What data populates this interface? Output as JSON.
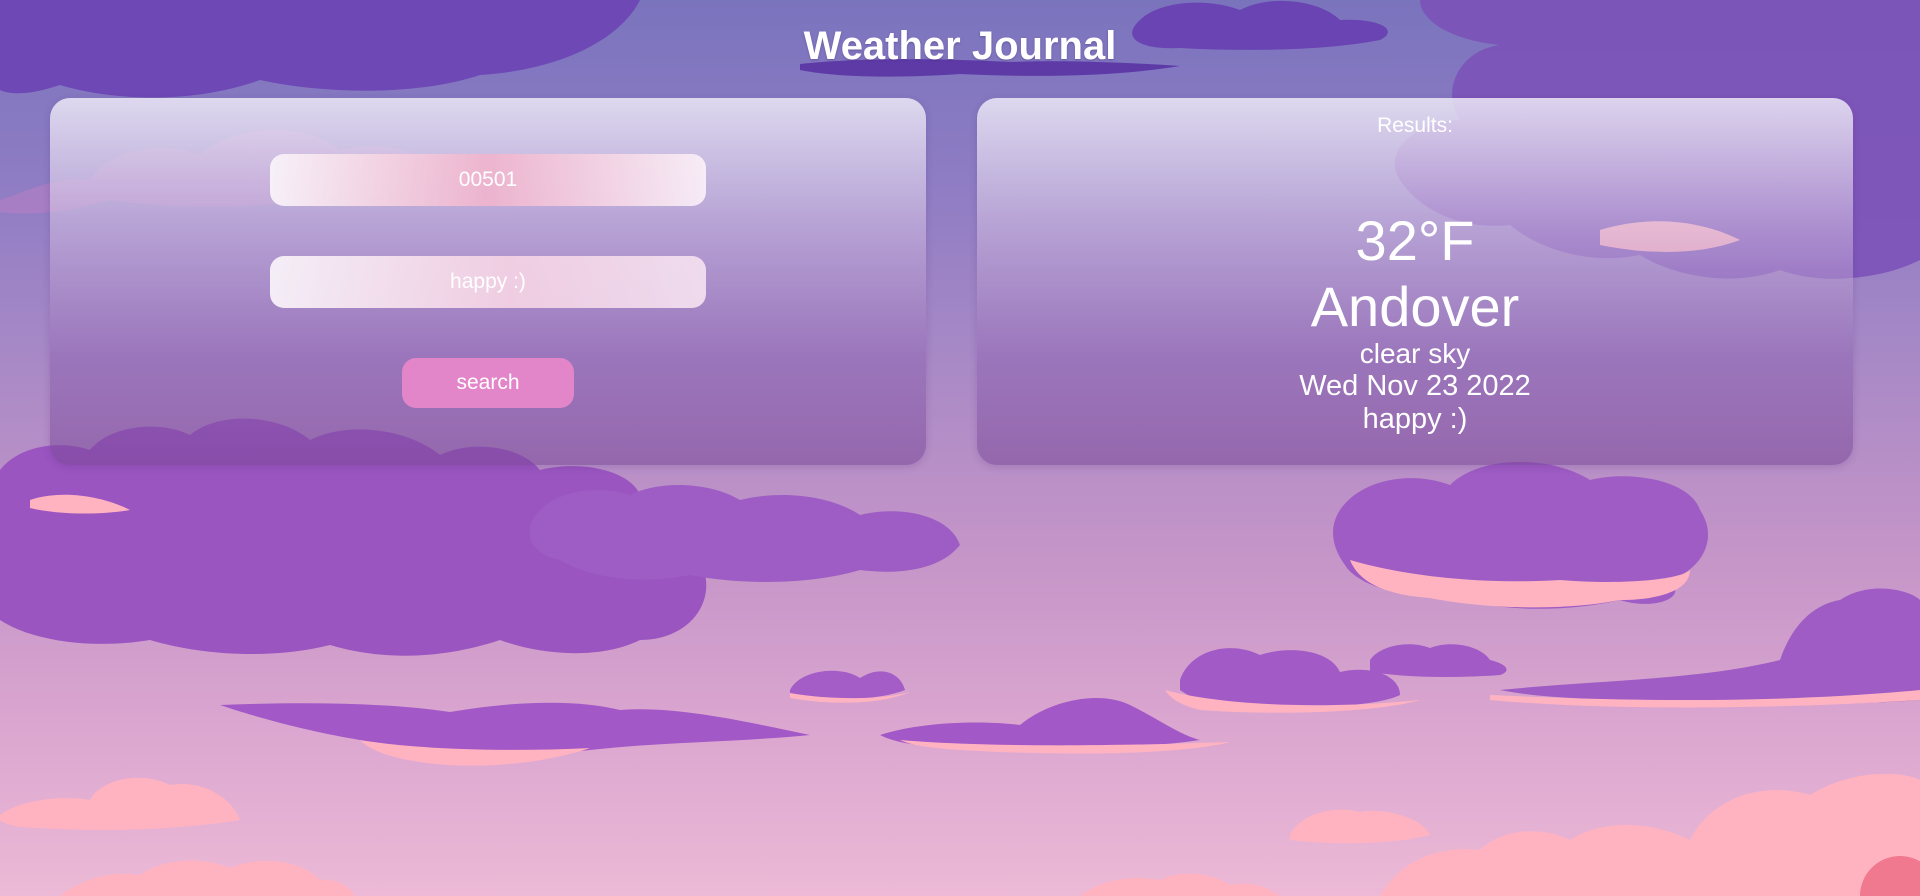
{
  "header": {
    "title": "Weather Journal"
  },
  "form": {
    "zip_value": "00501",
    "feelings_value": "happy :)",
    "search_label": "search"
  },
  "results": {
    "label": "Results:",
    "temperature": "32°F",
    "city": "Andover",
    "description": "clear sky",
    "date": "Wed Nov 23 2022",
    "feelings": "happy :)"
  },
  "colors": {
    "accent": "#e385c9",
    "cloud_purple": "#9a5cc0",
    "cloud_pink": "#ffb3c1"
  }
}
